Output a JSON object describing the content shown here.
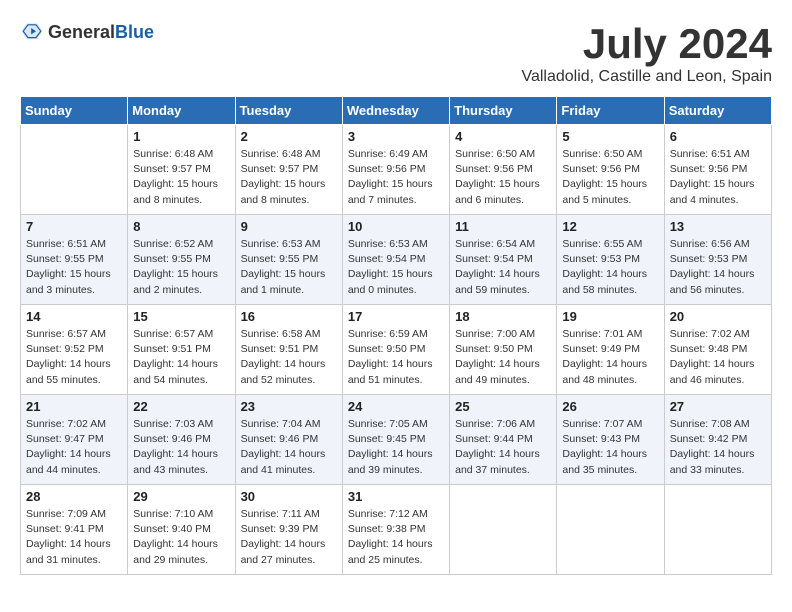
{
  "header": {
    "logo_general": "General",
    "logo_blue": "Blue",
    "month_title": "July 2024",
    "location": "Valladolid, Castille and Leon, Spain"
  },
  "weekdays": [
    "Sunday",
    "Monday",
    "Tuesday",
    "Wednesday",
    "Thursday",
    "Friday",
    "Saturday"
  ],
  "weeks": [
    [
      {
        "day": "",
        "sunrise": "",
        "sunset": "",
        "daylight": ""
      },
      {
        "day": "1",
        "sunrise": "Sunrise: 6:48 AM",
        "sunset": "Sunset: 9:57 PM",
        "daylight": "Daylight: 15 hours and 8 minutes."
      },
      {
        "day": "2",
        "sunrise": "Sunrise: 6:48 AM",
        "sunset": "Sunset: 9:57 PM",
        "daylight": "Daylight: 15 hours and 8 minutes."
      },
      {
        "day": "3",
        "sunrise": "Sunrise: 6:49 AM",
        "sunset": "Sunset: 9:56 PM",
        "daylight": "Daylight: 15 hours and 7 minutes."
      },
      {
        "day": "4",
        "sunrise": "Sunrise: 6:50 AM",
        "sunset": "Sunset: 9:56 PM",
        "daylight": "Daylight: 15 hours and 6 minutes."
      },
      {
        "day": "5",
        "sunrise": "Sunrise: 6:50 AM",
        "sunset": "Sunset: 9:56 PM",
        "daylight": "Daylight: 15 hours and 5 minutes."
      },
      {
        "day": "6",
        "sunrise": "Sunrise: 6:51 AM",
        "sunset": "Sunset: 9:56 PM",
        "daylight": "Daylight: 15 hours and 4 minutes."
      }
    ],
    [
      {
        "day": "7",
        "sunrise": "Sunrise: 6:51 AM",
        "sunset": "Sunset: 9:55 PM",
        "daylight": "Daylight: 15 hours and 3 minutes."
      },
      {
        "day": "8",
        "sunrise": "Sunrise: 6:52 AM",
        "sunset": "Sunset: 9:55 PM",
        "daylight": "Daylight: 15 hours and 2 minutes."
      },
      {
        "day": "9",
        "sunrise": "Sunrise: 6:53 AM",
        "sunset": "Sunset: 9:55 PM",
        "daylight": "Daylight: 15 hours and 1 minute."
      },
      {
        "day": "10",
        "sunrise": "Sunrise: 6:53 AM",
        "sunset": "Sunset: 9:54 PM",
        "daylight": "Daylight: 15 hours and 0 minutes."
      },
      {
        "day": "11",
        "sunrise": "Sunrise: 6:54 AM",
        "sunset": "Sunset: 9:54 PM",
        "daylight": "Daylight: 14 hours and 59 minutes."
      },
      {
        "day": "12",
        "sunrise": "Sunrise: 6:55 AM",
        "sunset": "Sunset: 9:53 PM",
        "daylight": "Daylight: 14 hours and 58 minutes."
      },
      {
        "day": "13",
        "sunrise": "Sunrise: 6:56 AM",
        "sunset": "Sunset: 9:53 PM",
        "daylight": "Daylight: 14 hours and 56 minutes."
      }
    ],
    [
      {
        "day": "14",
        "sunrise": "Sunrise: 6:57 AM",
        "sunset": "Sunset: 9:52 PM",
        "daylight": "Daylight: 14 hours and 55 minutes."
      },
      {
        "day": "15",
        "sunrise": "Sunrise: 6:57 AM",
        "sunset": "Sunset: 9:51 PM",
        "daylight": "Daylight: 14 hours and 54 minutes."
      },
      {
        "day": "16",
        "sunrise": "Sunrise: 6:58 AM",
        "sunset": "Sunset: 9:51 PM",
        "daylight": "Daylight: 14 hours and 52 minutes."
      },
      {
        "day": "17",
        "sunrise": "Sunrise: 6:59 AM",
        "sunset": "Sunset: 9:50 PM",
        "daylight": "Daylight: 14 hours and 51 minutes."
      },
      {
        "day": "18",
        "sunrise": "Sunrise: 7:00 AM",
        "sunset": "Sunset: 9:50 PM",
        "daylight": "Daylight: 14 hours and 49 minutes."
      },
      {
        "day": "19",
        "sunrise": "Sunrise: 7:01 AM",
        "sunset": "Sunset: 9:49 PM",
        "daylight": "Daylight: 14 hours and 48 minutes."
      },
      {
        "day": "20",
        "sunrise": "Sunrise: 7:02 AM",
        "sunset": "Sunset: 9:48 PM",
        "daylight": "Daylight: 14 hours and 46 minutes."
      }
    ],
    [
      {
        "day": "21",
        "sunrise": "Sunrise: 7:02 AM",
        "sunset": "Sunset: 9:47 PM",
        "daylight": "Daylight: 14 hours and 44 minutes."
      },
      {
        "day": "22",
        "sunrise": "Sunrise: 7:03 AM",
        "sunset": "Sunset: 9:46 PM",
        "daylight": "Daylight: 14 hours and 43 minutes."
      },
      {
        "day": "23",
        "sunrise": "Sunrise: 7:04 AM",
        "sunset": "Sunset: 9:46 PM",
        "daylight": "Daylight: 14 hours and 41 minutes."
      },
      {
        "day": "24",
        "sunrise": "Sunrise: 7:05 AM",
        "sunset": "Sunset: 9:45 PM",
        "daylight": "Daylight: 14 hours and 39 minutes."
      },
      {
        "day": "25",
        "sunrise": "Sunrise: 7:06 AM",
        "sunset": "Sunset: 9:44 PM",
        "daylight": "Daylight: 14 hours and 37 minutes."
      },
      {
        "day": "26",
        "sunrise": "Sunrise: 7:07 AM",
        "sunset": "Sunset: 9:43 PM",
        "daylight": "Daylight: 14 hours and 35 minutes."
      },
      {
        "day": "27",
        "sunrise": "Sunrise: 7:08 AM",
        "sunset": "Sunset: 9:42 PM",
        "daylight": "Daylight: 14 hours and 33 minutes."
      }
    ],
    [
      {
        "day": "28",
        "sunrise": "Sunrise: 7:09 AM",
        "sunset": "Sunset: 9:41 PM",
        "daylight": "Daylight: 14 hours and 31 minutes."
      },
      {
        "day": "29",
        "sunrise": "Sunrise: 7:10 AM",
        "sunset": "Sunset: 9:40 PM",
        "daylight": "Daylight: 14 hours and 29 minutes."
      },
      {
        "day": "30",
        "sunrise": "Sunrise: 7:11 AM",
        "sunset": "Sunset: 9:39 PM",
        "daylight": "Daylight: 14 hours and 27 minutes."
      },
      {
        "day": "31",
        "sunrise": "Sunrise: 7:12 AM",
        "sunset": "Sunset: 9:38 PM",
        "daylight": "Daylight: 14 hours and 25 minutes."
      },
      {
        "day": "",
        "sunrise": "",
        "sunset": "",
        "daylight": ""
      },
      {
        "day": "",
        "sunrise": "",
        "sunset": "",
        "daylight": ""
      },
      {
        "day": "",
        "sunrise": "",
        "sunset": "",
        "daylight": ""
      }
    ]
  ]
}
